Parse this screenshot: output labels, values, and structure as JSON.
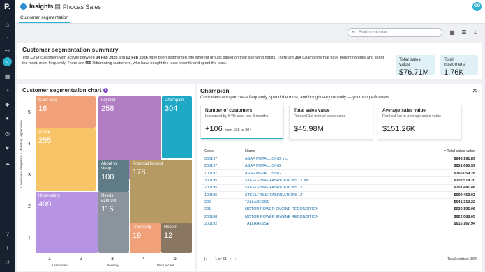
{
  "topbar": {
    "app_name": "Insights",
    "crumb": "Phocas Sales",
    "avatar": "GO",
    "tab": "Customer segmentation"
  },
  "toolbar": {
    "search_placeholder": "Find customer"
  },
  "summary": {
    "title": "Customer segmentation summary",
    "text_parts": {
      "p1": "The ",
      "customers": "1,757",
      "p2": " customers with activity between ",
      "d1": "04 Feb 2025",
      "p3": " and ",
      "d2": "03 Feb 2026",
      "p4": " have been segmented into different groups based on their spending habits. There are ",
      "champions": "304",
      "p5": " Champions that have bought recently and spent the most, most frequently. There are ",
      "hibernating": "499",
      "p6": " Hibernating customers, who have bought the least recently and spent the least."
    },
    "kpi_sales_label": "Total sales value",
    "kpi_sales_value": "$76.71M",
    "kpi_customers_label": "Total customers",
    "kpi_customers_value": "1.76K"
  },
  "chart": {
    "title": "Customer segmentation chart",
    "info": "i",
    "y_axis_label": "← Lower value     Frequency + Monetary     Higher value →",
    "x_axis_left": "← Less recent",
    "x_axis_mid": "Recency",
    "x_axis_right": "More recent →",
    "x_ticks": [
      "1",
      "2",
      "3",
      "4",
      "5"
    ],
    "y_ticks": [
      "5",
      "4",
      "3",
      "2",
      "1"
    ],
    "colors": {
      "cant_lose": "#f0a17a",
      "at_risk": "#f7c567",
      "loyalist": "#b07cc2",
      "champion": "#1fa8c6",
      "about_to_sleep": "#5f7b86",
      "potential_loyalist": "#b59a64",
      "hibernating": "#b793e3",
      "needs_attention": "#8b939c",
      "promising": "#f0a17a",
      "recent": "#8a7761"
    }
  },
  "chart_data": {
    "type": "heatmap",
    "title": "Customer segmentation chart",
    "xlabel": "Recency",
    "ylabel": "Frequency + Monetary",
    "segments": [
      {
        "name": "Can't lose",
        "value": 16
      },
      {
        "name": "At risk",
        "value": 255
      },
      {
        "name": "Loyalist",
        "value": 258
      },
      {
        "name": "Champion",
        "value": 304
      },
      {
        "name": "About to sleep",
        "value": 100
      },
      {
        "name": "Potential loyalist",
        "value": 178
      },
      {
        "name": "Hibernating",
        "value": 499
      },
      {
        "name": "Needs attention",
        "value": 116
      },
      {
        "name": "Promising",
        "value": 19
      },
      {
        "name": "Recent",
        "value": 12
      }
    ]
  },
  "detail": {
    "title": "Champion",
    "subtitle": "Customers who purchase frequently, spend the most, and bought very recently — your top performers.",
    "close": "✕",
    "m1_title": "Number of customers",
    "m1_sub": "Increased by 54% over last 3 months",
    "m1_value": "+106",
    "m1_note": "from 198 to 304",
    "m2_title": "Total sales value",
    "m2_sub": "Ranked 1st in total sales value",
    "m2_value": "$45.98M",
    "m3_title": "Average sales value",
    "m3_sub": "Ranked 1st in average sales value",
    "m3_value": "$151.26K"
  },
  "table": {
    "col_code": "Code",
    "col_name": "Name",
    "col_total": "Total sales value",
    "rows": [
      {
        "code": "300197",
        "name": "ASAP METALLISING Inc",
        "total": "$843,191.89"
      },
      {
        "code": "200197",
        "name": "ASAP METALLISING",
        "total": "$831,660.59"
      },
      {
        "code": "100197",
        "name": "ASAP METALLISING",
        "total": "$766,059.28"
      },
      {
        "code": "300195",
        "name": "STEELFINNE FABRICATIONS LT Inc",
        "total": "$702,518.20"
      },
      {
        "code": "200195",
        "name": "STEELFINNE FABRICATIONS LT",
        "total": "$701,481.48"
      },
      {
        "code": "100195",
        "name": "STEELFINNE FABRICATIONS LT",
        "total": "$699,463.03"
      },
      {
        "code": "206",
        "name": "TALLAHESSE",
        "total": "$641,310.22"
      },
      {
        "code": "201",
        "name": "MOTOR POWER ENGINE RECONDITION",
        "total": "$630,195.06"
      },
      {
        "code": "200188",
        "name": "MOTOR POWER ENGINE RECONDITION",
        "total": "$622,088.05"
      },
      {
        "code": "200192",
        "name": "TALLAHESSE",
        "total": "$616,167.94"
      }
    ],
    "pager": "1 of 31",
    "total_entries": "Total entries: 304"
  }
}
